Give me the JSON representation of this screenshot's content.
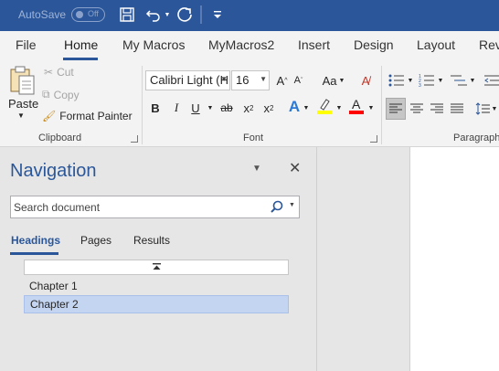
{
  "titlebar": {
    "autosave_label": "AutoSave",
    "autosave_state": "Off",
    "icons": [
      "save-icon",
      "undo-icon",
      "redo-icon",
      "customize-qat-icon"
    ]
  },
  "tabs": [
    {
      "label": "File"
    },
    {
      "label": "Home",
      "active": true
    },
    {
      "label": "My Macros"
    },
    {
      "label": "MyMacros2"
    },
    {
      "label": "Insert"
    },
    {
      "label": "Design"
    },
    {
      "label": "Layout"
    },
    {
      "label": "Rev"
    }
  ],
  "clipboard": {
    "paste": "Paste",
    "cut": "Cut",
    "copy": "Copy",
    "format_painter": "Format Painter",
    "group": "Clipboard"
  },
  "font": {
    "name": "Calibri Light (H",
    "size": "16",
    "group": "Font"
  },
  "paragraph": {
    "group": "Paragraph"
  },
  "navigation": {
    "title": "Navigation",
    "search_placeholder": "Search document",
    "tabs": [
      "Headings",
      "Pages",
      "Results"
    ],
    "active_tab": "Headings",
    "headings": [
      {
        "label": "Chapter 1",
        "selected": false
      },
      {
        "label": "Chapter 2",
        "selected": true
      }
    ]
  },
  "colors": {
    "brand": "#2b579a",
    "highlight": "#ffff00",
    "font_color": "#ff0000",
    "selection": "#c4d5f2"
  }
}
